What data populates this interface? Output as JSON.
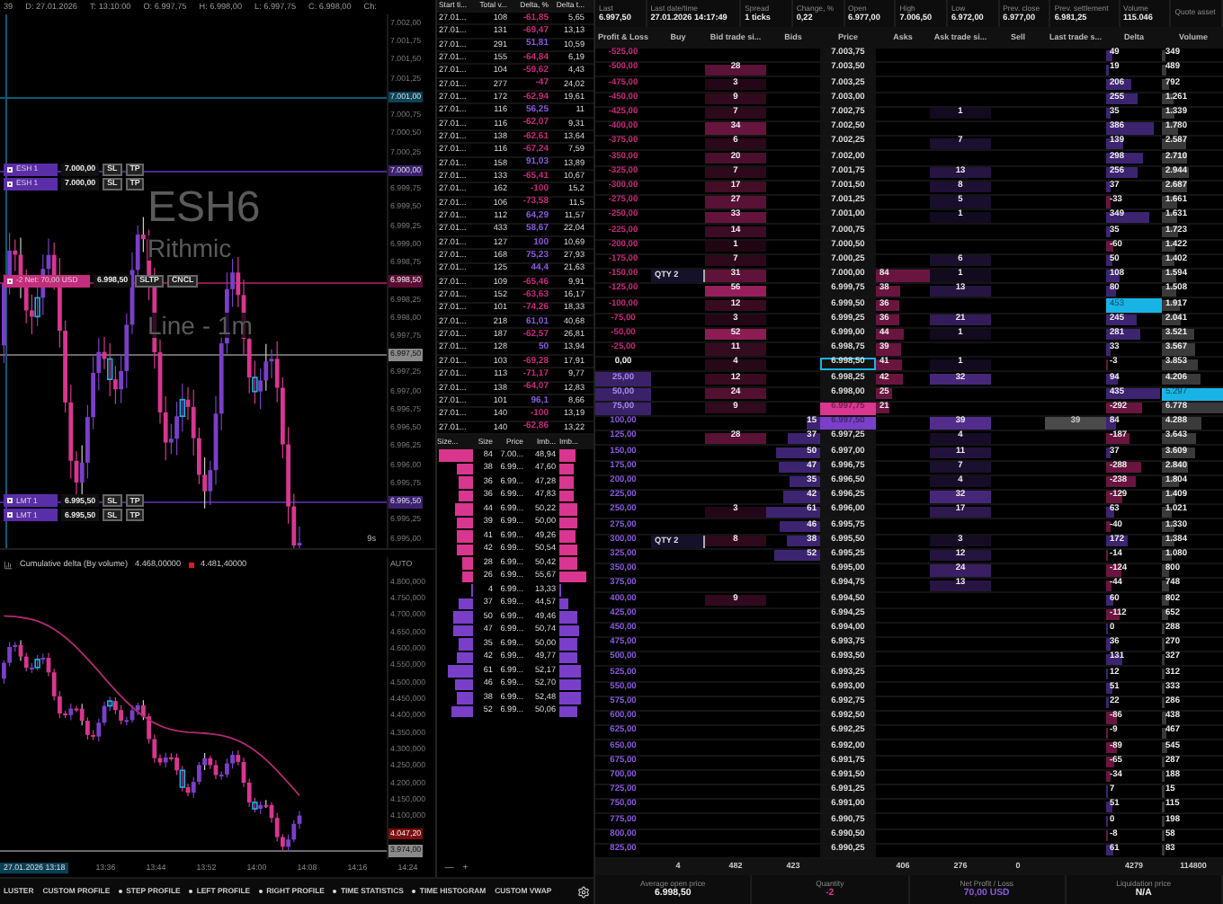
{
  "chart": {
    "info": [
      "39",
      "D: 27.01.2026",
      "T: 13:10:00",
      "O: 6.997,75",
      "H: 6.998,00",
      "L: 6.997,75",
      "C: 6.998,00",
      "Ch:"
    ],
    "watermark": [
      "ESH6",
      "Rithmic",
      "Line - 1m"
    ],
    "price_axis": [
      {
        "label": "7.002,00",
        "kind": "tick"
      },
      {
        "label": "7.001,75",
        "kind": "tick"
      },
      {
        "label": "7.001,50",
        "kind": "tick"
      },
      {
        "label": "7.001,25",
        "kind": "tick"
      },
      {
        "label": "7.001,00",
        "kind": "crosshair"
      },
      {
        "label": "7.000,75",
        "kind": "tick"
      },
      {
        "label": "7.000,50",
        "kind": "tick"
      },
      {
        "label": "7.000,25",
        "kind": "tick"
      },
      {
        "label": "7.000,00",
        "kind": "order",
        "orders": [
          {
            "label": "ESH 1",
            "price": "7.000,00",
            "buttons": [
              "SL",
              "TP"
            ]
          },
          {
            "label": "ESH 1",
            "price": "7.000,00",
            "buttons": [
              "SL",
              "TP"
            ]
          }
        ]
      },
      {
        "label": "6.999,75",
        "kind": "tick"
      },
      {
        "label": "6.999,50",
        "kind": "tick"
      },
      {
        "label": "6.999,25",
        "kind": "tick"
      },
      {
        "label": "6.999,00",
        "kind": "tick"
      },
      {
        "label": "6.998,75",
        "kind": "tick"
      },
      {
        "label": "6.998,50",
        "kind": "position",
        "orders": [
          {
            "label": "-2 Net: 70,00 USD",
            "price": "6.998,50",
            "buttons": [
              "SLTP",
              "CNCL"
            ]
          }
        ]
      },
      {
        "label": "6.998,25",
        "kind": "tick"
      },
      {
        "label": "6.998,00",
        "kind": "tick"
      },
      {
        "label": "6.997,75",
        "kind": "tick"
      },
      {
        "label": "6.997,50",
        "kind": "last"
      },
      {
        "label": "6.997,25",
        "kind": "tick"
      },
      {
        "label": "6.997,00",
        "kind": "tick"
      },
      {
        "label": "6.996,75",
        "kind": "tick"
      },
      {
        "label": "6.996,50",
        "kind": "tick"
      },
      {
        "label": "6.996,25",
        "kind": "tick"
      },
      {
        "label": "6.996,00",
        "kind": "tick"
      },
      {
        "label": "6.995,75",
        "kind": "tick"
      },
      {
        "label": "6.995,50",
        "kind": "order",
        "orders": [
          {
            "label": "LMT 1",
            "price": "6.995,50",
            "buttons": [
              "SL",
              "TP"
            ]
          },
          {
            "label": "LMT 1",
            "price": "6.995,50",
            "buttons": [
              "SL",
              "TP"
            ]
          }
        ]
      },
      {
        "label": "6.995,25",
        "kind": "tick"
      },
      {
        "label": "6.995,00",
        "kind": "tick"
      }
    ],
    "interval_label": "9s"
  },
  "indicator": {
    "title": "Cumulative delta (By volume)",
    "values": [
      {
        "text": "4.468,00000"
      },
      {
        "text": "4.481,40000",
        "color": "#e01818"
      }
    ],
    "axis": [
      {
        "label": "AUTO",
        "kind": "auto"
      },
      {
        "label": "4.800,000",
        "kind": "tick"
      },
      {
        "label": "4.750,000",
        "kind": "tick"
      },
      {
        "label": "4.700,000",
        "kind": "tick"
      },
      {
        "label": "4.650,000",
        "kind": "tick"
      },
      {
        "label": "4.600,000",
        "kind": "tick"
      },
      {
        "label": "4.550,000",
        "kind": "tick"
      },
      {
        "label": "4.500,000",
        "kind": "tick"
      },
      {
        "label": "4.450,000",
        "kind": "tick"
      },
      {
        "label": "4.400,000",
        "kind": "tick"
      },
      {
        "label": "4.350,000",
        "kind": "tick"
      },
      {
        "label": "4.300,000",
        "kind": "tick"
      },
      {
        "label": "4.250,000",
        "kind": "tick"
      },
      {
        "label": "4.200,000",
        "kind": "tick"
      },
      {
        "label": "4.150,000",
        "kind": "tick"
      },
      {
        "label": "4.100,000",
        "kind": "tick"
      },
      {
        "label": "4.047,20",
        "kind": "value"
      },
      {
        "label": "3.974,00",
        "kind": "last"
      }
    ],
    "time_axis": [
      {
        "label": "27.01.2026 13:18",
        "selected": true
      },
      {
        "label": "13:36",
        "selected": false
      },
      {
        "label": "13:44",
        "selected": false
      },
      {
        "label": "13:52",
        "selected": false
      },
      {
        "label": "14:00",
        "selected": false
      },
      {
        "label": "14:08",
        "selected": false
      },
      {
        "label": "14:16",
        "selected": false
      },
      {
        "label": "14:24",
        "selected": false
      }
    ],
    "zoom_controls": [
      "—",
      "+"
    ]
  },
  "bottom_tabs": [
    {
      "label": "LUSTER",
      "dot": false
    },
    {
      "label": "CUSTOM PROFILE",
      "dot": false
    },
    {
      "label": "STEP PROFILE",
      "dot": true
    },
    {
      "label": "LEFT PROFILE",
      "dot": true
    },
    {
      "label": "RIGHT PROFILE",
      "dot": true
    },
    {
      "label": "TIME STATISTICS",
      "dot": true
    },
    {
      "label": "TIME HISTOGRAM",
      "dot": true
    },
    {
      "label": "CUSTOM VWAP",
      "dot": false
    }
  ],
  "time_and_sales": {
    "columns": [
      "Start ti...",
      "Total v...",
      "Delta, %",
      "Delta t..."
    ],
    "rows": [
      {
        "time": "27.01...",
        "volume": "108",
        "delta": "-61,85",
        "delta_per_trade": "5,65",
        "color": "#c82a7c"
      },
      {
        "time": "27.01...",
        "volume": "131",
        "delta": "-69,47",
        "delta_per_trade": "13,13",
        "color": "#c82a7c"
      },
      {
        "time": "27.01...",
        "volume": "291",
        "delta": "51,81",
        "delta_per_trade": "10,59",
        "color": "#8a5ae0"
      },
      {
        "time": "27.01...",
        "volume": "155",
        "delta": "-64,84",
        "delta_per_trade": "6,19",
        "color": "#c82a7c"
      },
      {
        "time": "27.01...",
        "volume": "104",
        "delta": "-59,62",
        "delta_per_trade": "4,43",
        "color": "#c82a7c"
      },
      {
        "time": "27.01...",
        "volume": "277",
        "delta": "-47",
        "delta_per_trade": "24,02",
        "color": "#c82a7c"
      },
      {
        "time": "27.01...",
        "volume": "172",
        "delta": "-62,94",
        "delta_per_trade": "19,61",
        "color": "#c82a7c"
      },
      {
        "time": "27.01...",
        "volume": "116",
        "delta": "56,25",
        "delta_per_trade": "11",
        "color": "#8a5ae0"
      },
      {
        "time": "27.01...",
        "volume": "116",
        "delta": "-62,07",
        "delta_per_trade": "9,31",
        "color": "#c82a7c"
      },
      {
        "time": "27.01...",
        "volume": "138",
        "delta": "-62,61",
        "delta_per_trade": "13,64",
        "color": "#c82a7c"
      },
      {
        "time": "27.01...",
        "volume": "116",
        "delta": "-67,24",
        "delta_per_trade": "7,59",
        "color": "#c82a7c"
      },
      {
        "time": "27.01...",
        "volume": "158",
        "delta": "91,03",
        "delta_per_trade": "13,89",
        "color": "#8a5ae0"
      },
      {
        "time": "27.01...",
        "volume": "133",
        "delta": "-65,41",
        "delta_per_trade": "10,67",
        "color": "#c82a7c"
      },
      {
        "time": "27.01...",
        "volume": "162",
        "delta": "-100",
        "delta_per_trade": "15,2",
        "color": "#c82a7c"
      },
      {
        "time": "27.01...",
        "volume": "106",
        "delta": "-73,58",
        "delta_per_trade": "11,5",
        "color": "#c82a7c"
      },
      {
        "time": "27.01...",
        "volume": "112",
        "delta": "64,29",
        "delta_per_trade": "11,57",
        "color": "#8a5ae0"
      },
      {
        "time": "27.01...",
        "volume": "433",
        "delta": "58,67",
        "delta_per_trade": "22,04",
        "color": "#8a5ae0"
      },
      {
        "time": "27.01...",
        "volume": "127",
        "delta": "100",
        "delta_per_trade": "10,69",
        "color": "#8a5ae0"
      },
      {
        "time": "27.01...",
        "volume": "168",
        "delta": "75,23",
        "delta_per_trade": "27,93",
        "color": "#8a5ae0"
      },
      {
        "time": "27.01...",
        "volume": "125",
        "delta": "44,4",
        "delta_per_trade": "21,63",
        "color": "#8a5ae0"
      },
      {
        "time": "27.01...",
        "volume": "109",
        "delta": "-65,46",
        "delta_per_trade": "9,91",
        "color": "#c82a7c"
      },
      {
        "time": "27.01...",
        "volume": "152",
        "delta": "-63,63",
        "delta_per_trade": "16,17",
        "color": "#c82a7c"
      },
      {
        "time": "27.01...",
        "volume": "101",
        "delta": "-74,26",
        "delta_per_trade": "18,33",
        "color": "#c82a7c"
      },
      {
        "time": "27.01...",
        "volume": "218",
        "delta": "61,01",
        "delta_per_trade": "40,68",
        "color": "#8a5ae0"
      },
      {
        "time": "27.01...",
        "volume": "187",
        "delta": "-62,57",
        "delta_per_trade": "26,81",
        "color": "#c82a7c"
      },
      {
        "time": "27.01...",
        "volume": "128",
        "delta": "50",
        "delta_per_trade": "13,94",
        "color": "#8a5ae0"
      },
      {
        "time": "27.01...",
        "volume": "103",
        "delta": "-69,28",
        "delta_per_trade": "17,91",
        "color": "#c82a7c"
      },
      {
        "time": "27.01...",
        "volume": "113",
        "delta": "-71,17",
        "delta_per_trade": "9,77",
        "color": "#c82a7c"
      },
      {
        "time": "27.01...",
        "volume": "138",
        "delta": "-64,07",
        "delta_per_trade": "12,83",
        "color": "#c82a7c"
      },
      {
        "time": "27.01...",
        "volume": "101",
        "delta": "96,1",
        "delta_per_trade": "8,66",
        "color": "#8a5ae0"
      },
      {
        "time": "27.01...",
        "volume": "140",
        "delta": "-100",
        "delta_per_trade": "13,19",
        "color": "#c82a7c"
      },
      {
        "time": "27.01...",
        "volume": "140",
        "delta": "-62,86",
        "delta_per_trade": "13,22",
        "color": "#c82a7c"
      }
    ]
  },
  "volume_profile": {
    "columns": [
      "Size...",
      "Size",
      "Price",
      "Imb...",
      "Imb..."
    ],
    "rows": [
      {
        "size": "84",
        "price": "7.00...",
        "imbalance": "48,94",
        "color": "#d8368f"
      },
      {
        "size": "38",
        "price": "6.99...",
        "imbalance": "47,60",
        "color": "#d8368f"
      },
      {
        "size": "36",
        "price": "6.99...",
        "imbalance": "47,28",
        "color": "#d8368f"
      },
      {
        "size": "36",
        "price": "6.99...",
        "imbalance": "47,83",
        "color": "#d8368f"
      },
      {
        "size": "44",
        "price": "6.99...",
        "imbalance": "50,22",
        "color": "#d8368f"
      },
      {
        "size": "39",
        "price": "6.99...",
        "imbalance": "50,00",
        "color": "#d8368f"
      },
      {
        "size": "41",
        "price": "6.99...",
        "imbalance": "49,26",
        "color": "#d8368f"
      },
      {
        "size": "42",
        "price": "6.99...",
        "imbalance": "50,54",
        "color": "#d8368f"
      },
      {
        "size": "28",
        "price": "6.99...",
        "imbalance": "50,42",
        "color": "#d8368f"
      },
      {
        "size": "26",
        "price": "6.99...",
        "imbalance": "55,67",
        "color": "#d8368f"
      },
      {
        "size": "4",
        "price": "6.99...",
        "imbalance": "13,33",
        "color": "#7a3fc8"
      },
      {
        "size": "37",
        "price": "6.99...",
        "imbalance": "44,57",
        "color": "#7a3fc8"
      },
      {
        "size": "50",
        "price": "6.99...",
        "imbalance": "49,46",
        "color": "#7a3fc8"
      },
      {
        "size": "47",
        "price": "6.99...",
        "imbalance": "50,74",
        "color": "#7a3fc8"
      },
      {
        "size": "35",
        "price": "6.99...",
        "imbalance": "50,00",
        "color": "#7a3fc8"
      },
      {
        "size": "42",
        "price": "6.99...",
        "imbalance": "49,77",
        "color": "#7a3fc8"
      },
      {
        "size": "61",
        "price": "6.99...",
        "imbalance": "52,17",
        "color": "#7a3fc8"
      },
      {
        "size": "46",
        "price": "6.99...",
        "imbalance": "52,70",
        "color": "#7a3fc8"
      },
      {
        "size": "38",
        "price": "6.99...",
        "imbalance": "52,48",
        "color": "#7a3fc8"
      },
      {
        "size": "52",
        "price": "6.99...",
        "imbalance": "50,06",
        "color": "#7a3fc8"
      }
    ]
  },
  "dom": {
    "stats": [
      {
        "label": "Last",
        "value": "6.997,50"
      },
      {
        "label": "Last date/time",
        "value": "27.01.2026 14:17:49"
      },
      {
        "label": "Spread",
        "value": "1 ticks"
      },
      {
        "label": "Change, %",
        "value": "0,22"
      },
      {
        "label": "Open",
        "value": "6.977,00"
      },
      {
        "label": "High",
        "value": "7.006,50"
      },
      {
        "label": "Low",
        "value": "6.972,00"
      },
      {
        "label": "Prev. close",
        "value": "6.977,00"
      },
      {
        "label": "Prev. settlement",
        "value": "6.981,25"
      },
      {
        "label": "Volume",
        "value": "115.046"
      },
      {
        "label": "Quote asset"
      }
    ],
    "columns": [
      "Profit & Loss",
      "Buy",
      "Bid trade si...",
      "Bids",
      "Price",
      "Asks",
      "Ask trade si...",
      "Sell",
      "Last trade s...",
      "Delta",
      "Volume"
    ],
    "rows": [
      {
        "pnl": "-525,00",
        "price": "7.003,75",
        "delta": "49",
        "volume": "349"
      },
      {
        "pnl": "-500,00",
        "bid_trade": "28",
        "price": "7.003,50",
        "delta": "19",
        "volume": "489"
      },
      {
        "pnl": "-475,00",
        "bid_trade": "3",
        "price": "7.003,25",
        "delta": "206",
        "volume": "792"
      },
      {
        "pnl": "-450,00",
        "bid_trade": "9",
        "price": "7.003,00",
        "delta": "255",
        "volume": "1.261"
      },
      {
        "pnl": "-425,00",
        "bid_trade": "7",
        "price": "7.002,75",
        "ask_trade": "1",
        "delta": "35",
        "volume": "1.339"
      },
      {
        "pnl": "-400,00",
        "bid_trade": "34",
        "price": "7.002,50",
        "delta": "386",
        "volume": "1.780"
      },
      {
        "pnl": "-375,00",
        "bid_trade": "6",
        "price": "7.002,25",
        "ask_trade": "7",
        "delta": "139",
        "volume": "2.587"
      },
      {
        "pnl": "-350,00",
        "bid_trade": "20",
        "price": "7.002,00",
        "delta": "298",
        "volume": "2.710"
      },
      {
        "pnl": "-325,00",
        "bid_trade": "7",
        "price": "7.001,75",
        "ask_trade": "13",
        "delta": "256",
        "volume": "2.944"
      },
      {
        "pnl": "-300,00",
        "bid_trade": "17",
        "price": "7.001,50",
        "ask_trade": "8",
        "delta": "37",
        "volume": "2.687"
      },
      {
        "pnl": "-275,00",
        "bid_trade": "27",
        "price": "7.001,25",
        "ask_trade": "5",
        "delta": "-33",
        "volume": "1.661"
      },
      {
        "pnl": "-250,00",
        "bid_trade": "33",
        "price": "7.001,00",
        "ask_trade": "1",
        "delta": "349",
        "volume": "1.631"
      },
      {
        "pnl": "-225,00",
        "bid_trade": "14",
        "price": "7.000,75",
        "delta": "35",
        "volume": "1.723"
      },
      {
        "pnl": "-200,00",
        "bid_trade": "1",
        "price": "7.000,50",
        "delta": "-60",
        "volume": "1.422"
      },
      {
        "pnl": "-175,00",
        "bid_trade": "7",
        "price": "7.000,25",
        "ask_trade": "6",
        "delta": "50",
        "volume": "1.402"
      },
      {
        "pnl": "-150,00",
        "buy_order": "QTY 2",
        "bid_trade": "31",
        "price": "7.000,00",
        "asks": "84",
        "ask_trade": "1",
        "delta": "108",
        "volume": "1.594"
      },
      {
        "pnl": "-125,00",
        "bid_trade": "56",
        "price": "6.999,75",
        "asks": "38",
        "ask_trade": "13",
        "delta": "80",
        "volume": "1.508"
      },
      {
        "pnl": "-100,00",
        "bid_trade": "12",
        "price": "6.999,50",
        "asks": "36",
        "delta": "453",
        "delta_highlight": true,
        "volume": "1.917"
      },
      {
        "pnl": "-75,00",
        "bid_trade": "3",
        "price": "6.999,25",
        "asks": "36",
        "ask_trade": "21",
        "delta": "245",
        "volume": "2.041"
      },
      {
        "pnl": "-50,00",
        "bid_trade": "52",
        "price": "6.999,00",
        "asks": "44",
        "ask_trade": "1",
        "delta": "281",
        "volume": "3.521"
      },
      {
        "pnl": "-25,00",
        "bid_trade": "11",
        "price": "6.998,75",
        "asks": "39",
        "delta": "33",
        "volume": "3.567"
      },
      {
        "pnl": "0,00",
        "bid_trade": "4",
        "price": "6.998,50",
        "price_outlined": true,
        "asks": "41",
        "ask_trade": "1",
        "delta": "-3",
        "volume": "3.853"
      },
      {
        "pnl": "25,00",
        "pnl_fill": true,
        "bid_trade": "12",
        "price": "6.998,25",
        "asks": "42",
        "ask_trade": "32",
        "delta": "94",
        "volume": "4.206"
      },
      {
        "pnl": "50,00",
        "pnl_fill": true,
        "bid_trade": "24",
        "price": "6.998,00",
        "asks": "25",
        "delta": "435",
        "volume": "5.297",
        "volume_highlight": true
      },
      {
        "pnl": "75,00",
        "pnl_fill": true,
        "bid_trade": "9",
        "price": "6.997,75",
        "best_ask": true,
        "asks": "21",
        "delta": "-292",
        "volume": "6.778"
      },
      {
        "pnl": "100,00",
        "bids": "15",
        "price": "6.997,50",
        "best_bid": true,
        "ask_trade": "39",
        "last_trade": "39",
        "delta": "84",
        "volume": "4.288"
      },
      {
        "pnl": "125,00",
        "bid_trade": "28",
        "bids": "37",
        "price": "6.997,25",
        "ask_trade": "4",
        "delta": "-187",
        "volume": "3.643"
      },
      {
        "pnl": "150,00",
        "bids": "50",
        "price": "6.997,00",
        "ask_trade": "11",
        "delta": "37",
        "volume": "3.609"
      },
      {
        "pnl": "175,00",
        "bids": "47",
        "price": "6.996,75",
        "ask_trade": "7",
        "delta": "-288",
        "volume": "2.840"
      },
      {
        "pnl": "200,00",
        "bids": "35",
        "price": "6.996,50",
        "ask_trade": "4",
        "delta": "-238",
        "volume": "1.804"
      },
      {
        "pnl": "225,00",
        "bids": "42",
        "price": "6.996,25",
        "ask_trade": "32",
        "delta": "-129",
        "volume": "1.409"
      },
      {
        "pnl": "250,00",
        "bid_trade": "3",
        "bids": "61",
        "price": "6.996,00",
        "ask_trade": "17",
        "delta": "63",
        "volume": "1.021"
      },
      {
        "pnl": "275,00",
        "bids": "46",
        "price": "6.995,75",
        "delta": "-40",
        "volume": "1.330"
      },
      {
        "pnl": "300,00",
        "buy_order": "QTY 2",
        "bid_trade": "8",
        "bids": "38",
        "price": "6.995,50",
        "ask_trade": "3",
        "delta": "172",
        "volume": "1.384"
      },
      {
        "pnl": "325,00",
        "bids": "52",
        "price": "6.995,25",
        "ask_trade": "12",
        "delta": "-14",
        "volume": "1.080"
      },
      {
        "pnl": "350,00",
        "price": "6.995,00",
        "ask_trade": "24",
        "delta": "-124",
        "volume": "800"
      },
      {
        "pnl": "375,00",
        "price": "6.994,75",
        "ask_trade": "13",
        "delta": "-44",
        "volume": "748"
      },
      {
        "pnl": "400,00",
        "bid_trade": "9",
        "price": "6.994,50",
        "delta": "60",
        "volume": "802"
      },
      {
        "pnl": "425,00",
        "price": "6.994,25",
        "delta": "-112",
        "volume": "652"
      },
      {
        "pnl": "450,00",
        "price": "6.994,00",
        "delta": "0",
        "volume": "288"
      },
      {
        "pnl": "475,00",
        "price": "6.993,75",
        "delta": "36",
        "volume": "270"
      },
      {
        "pnl": "500,00",
        "price": "6.993,50",
        "delta": "131",
        "volume": "327"
      },
      {
        "pnl": "525,00",
        "price": "6.993,25",
        "delta": "12",
        "volume": "312"
      },
      {
        "pnl": "550,00",
        "price": "6.993,00",
        "delta": "51",
        "volume": "333"
      },
      {
        "pnl": "575,00",
        "price": "6.992,75",
        "delta": "22",
        "volume": "286"
      },
      {
        "pnl": "600,00",
        "price": "6.992,50",
        "delta": "-86",
        "volume": "438"
      },
      {
        "pnl": "625,00",
        "price": "6.992,25",
        "delta": "-9",
        "volume": "467"
      },
      {
        "pnl": "650,00",
        "price": "6.992,00",
        "delta": "-89",
        "volume": "545"
      },
      {
        "pnl": "675,00",
        "price": "6.991,75",
        "delta": "-65",
        "volume": "287"
      },
      {
        "pnl": "700,00",
        "price": "6.991,50",
        "delta": "-34",
        "volume": "188"
      },
      {
        "pnl": "725,00",
        "price": "6.991,25",
        "delta": "7",
        "volume": "15"
      },
      {
        "pnl": "750,00",
        "price": "6.991,00",
        "delta": "51",
        "volume": "115"
      },
      {
        "pnl": "775,00",
        "price": "6.990,75",
        "delta": "0",
        "volume": "198"
      },
      {
        "pnl": "800,00",
        "price": "6.990,50",
        "delta": "-8",
        "volume": "58"
      },
      {
        "pnl": "825,00",
        "price": "6.990,25",
        "delta": "61",
        "volume": "83"
      }
    ],
    "totals": {
      "buy": "4",
      "bid_trade": "482",
      "bids": "423",
      "asks": "406",
      "ask_trade": "276",
      "sell": "0",
      "delta": "4279",
      "volume": "114800"
    },
    "footer": [
      {
        "label": "Average open price",
        "value": "6.998,50",
        "color": "#eeeeee"
      },
      {
        "label": "Quantity",
        "value": "-2",
        "color": "#d8368f"
      },
      {
        "label": "Net Profit / Loss",
        "value": "70,00 USD",
        "color": "#8a5ae0"
      },
      {
        "label": "Liquidation price",
        "value": "N/A",
        "color": "#eeeeee"
      }
    ]
  }
}
